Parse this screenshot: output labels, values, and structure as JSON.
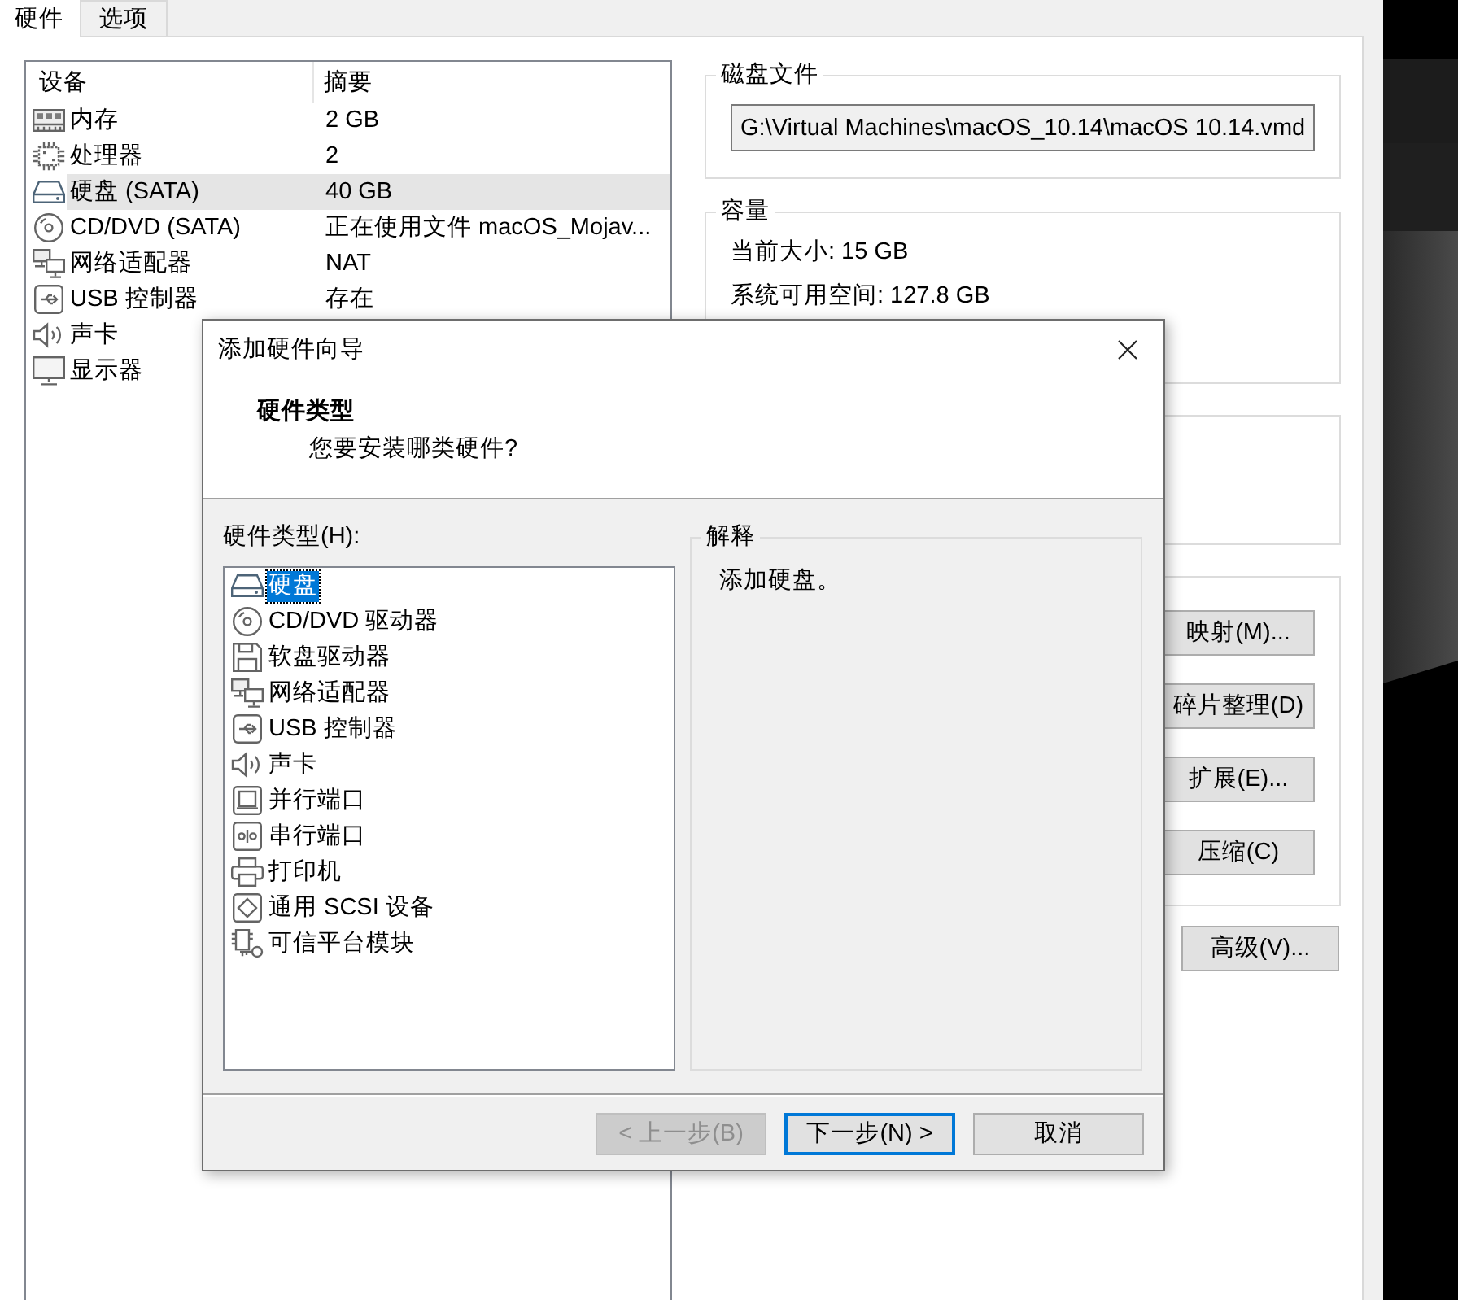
{
  "tabs": [
    {
      "label": "硬件",
      "selected": true
    },
    {
      "label": "选项",
      "selected": false
    }
  ],
  "device_list": {
    "columns": [
      "设备",
      "摘要"
    ],
    "rows": [
      {
        "kind": "memory",
        "device": "内存",
        "summary": "2 GB",
        "selected": false
      },
      {
        "kind": "cpu",
        "device": "处理器",
        "summary": "2",
        "selected": false
      },
      {
        "kind": "disk",
        "device": "硬盘 (SATA)",
        "summary": "40 GB",
        "selected": true
      },
      {
        "kind": "cdrom",
        "device": "CD/DVD (SATA)",
        "summary": "正在使用文件 macOS_Mojav...",
        "selected": false
      },
      {
        "kind": "network",
        "device": "网络适配器",
        "summary": "NAT",
        "selected": false
      },
      {
        "kind": "usb",
        "device": "USB 控制器",
        "summary": "存在",
        "selected": false
      },
      {
        "kind": "sound",
        "device": "声卡",
        "selected": false
      },
      {
        "kind": "display",
        "device": "显示器",
        "selected": false
      }
    ]
  },
  "disk_file": {
    "label": "磁盘文件",
    "path": "G:\\Virtual Machines\\macOS_10.14\\macOS 10.14.vmd"
  },
  "capacity": {
    "label": "容量",
    "lines": [
      "当前大小: 15 GB",
      "系统可用空间: 127.8 GB"
    ]
  },
  "disk_utilities": {
    "buttons": [
      "映射(M)...",
      "碎片整理(D)",
      "扩展(E)...",
      "压缩(C)"
    ]
  },
  "advanced_button": "高级(V)...",
  "dialog": {
    "title": "添加硬件向导",
    "heading": "硬件类型",
    "subheading": "您要安装哪类硬件?",
    "list_label": "硬件类型(H):",
    "hardware_types": [
      {
        "kind": "disk",
        "label": "硬盘",
        "selected": true
      },
      {
        "kind": "cdrom",
        "label": "CD/DVD 驱动器",
        "selected": false
      },
      {
        "kind": "floppy",
        "label": "软盘驱动器",
        "selected": false
      },
      {
        "kind": "network",
        "label": "网络适配器",
        "selected": false
      },
      {
        "kind": "usb",
        "label": "USB 控制器",
        "selected": false
      },
      {
        "kind": "sound",
        "label": "声卡",
        "selected": false
      },
      {
        "kind": "parallel",
        "label": "并行端口",
        "selected": false
      },
      {
        "kind": "serial",
        "label": "串行端口",
        "selected": false
      },
      {
        "kind": "printer",
        "label": "打印机",
        "selected": false
      },
      {
        "kind": "scsi",
        "label": "通用 SCSI 设备",
        "selected": false
      },
      {
        "kind": "tpm",
        "label": "可信平台模块",
        "selected": false
      }
    ],
    "explanation": {
      "label": "解释",
      "text": "添加硬盘。"
    },
    "buttons": [
      {
        "label": "< 上一步(B)",
        "disabled": true,
        "focused": false
      },
      {
        "label": "下一步(N) >",
        "disabled": false,
        "focused": true
      },
      {
        "label": "取消",
        "disabled": false,
        "focused": false
      }
    ]
  }
}
